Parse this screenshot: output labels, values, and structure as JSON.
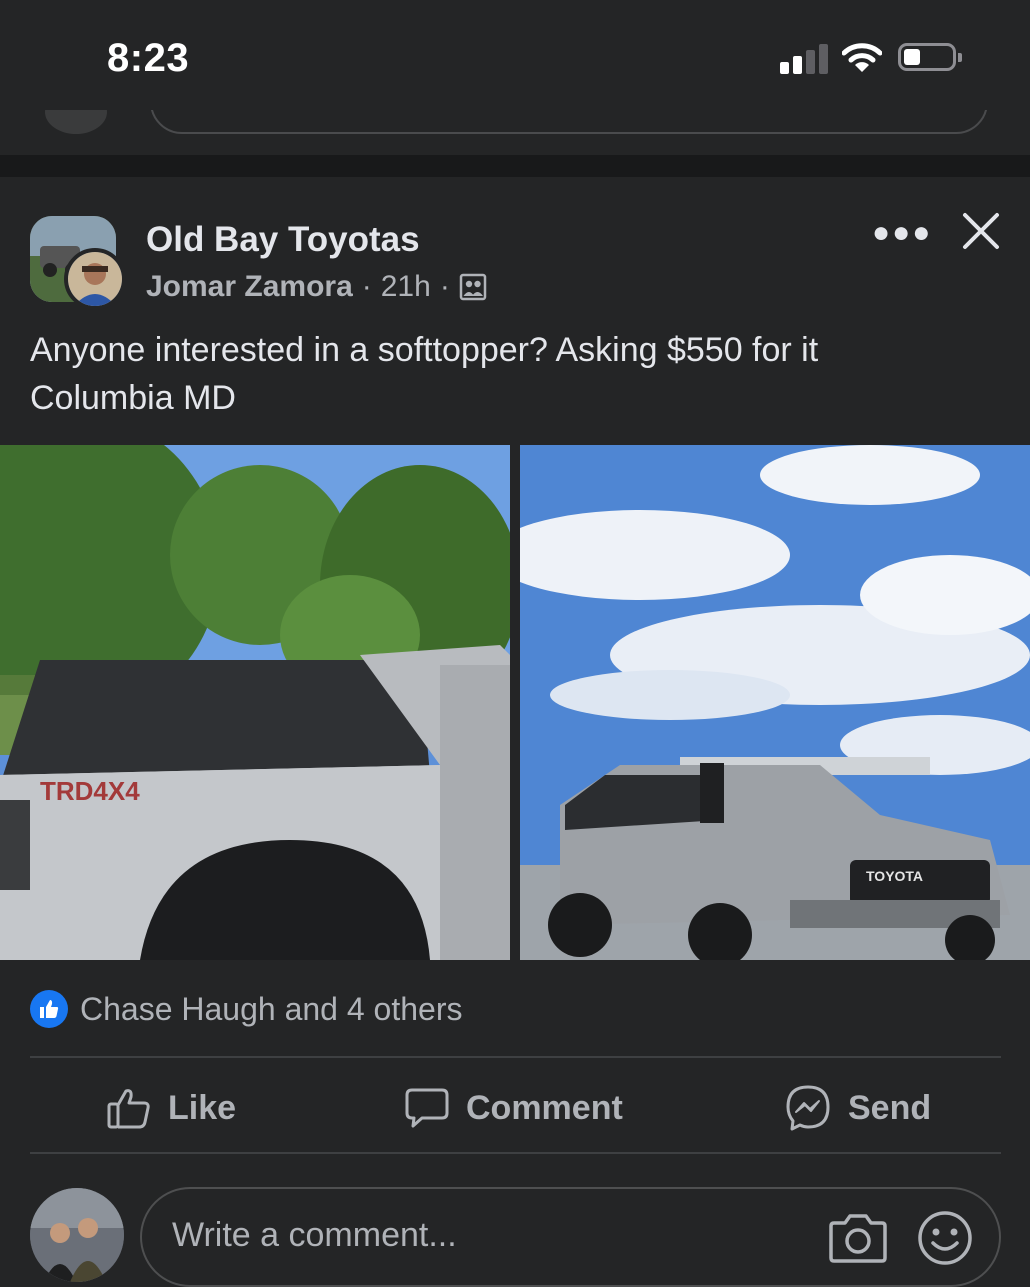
{
  "status_bar": {
    "time": "8:23",
    "signal_bars": 2,
    "battery_level": 0.3
  },
  "post": {
    "group_name": "Old Bay Toyotas",
    "author": "Jomar Zamora",
    "separator": "·",
    "time_ago": "21h",
    "privacy_icon": "group-members-icon",
    "text_line1": "Anyone interested in a softtopper? Asking $550 for it",
    "text_line2": "Columbia MD",
    "reactions_text": "Chase Haugh and 4 others"
  },
  "actions": {
    "like": "Like",
    "comment": "Comment",
    "send": "Send"
  },
  "comment_input": {
    "placeholder": "Write a comment..."
  },
  "colors": {
    "background": "#242526",
    "text": "#e4e6eb",
    "secondary_text": "#b0b3b8",
    "like_blue": "#1877f2"
  }
}
